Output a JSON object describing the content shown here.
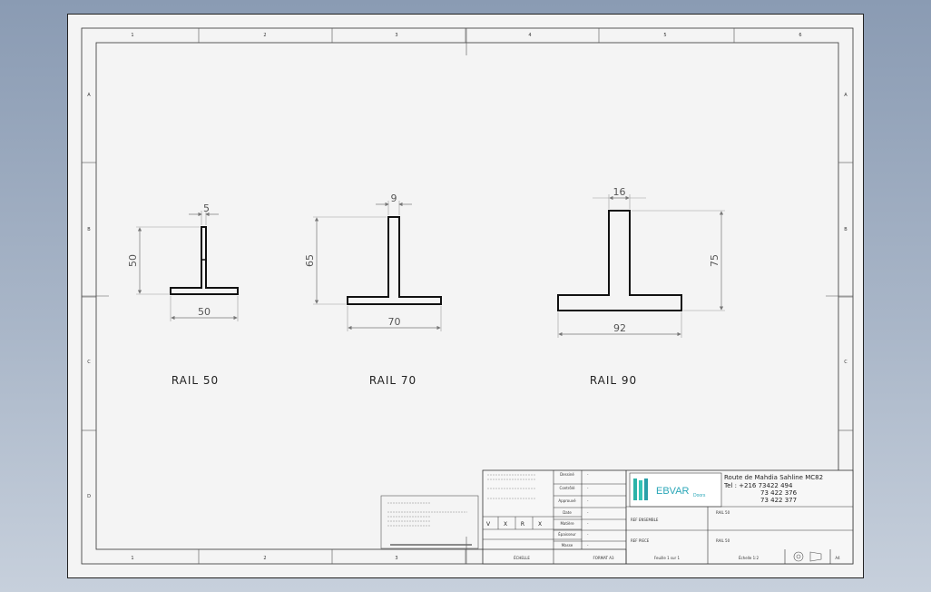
{
  "zones": {
    "columns": [
      "1",
      "2",
      "3",
      "4",
      "5",
      "6"
    ],
    "rows": [
      "A",
      "B",
      "C",
      "D"
    ]
  },
  "rails": [
    {
      "label": "RAIL 50",
      "width_dim": "50",
      "height_dim": "50",
      "stem_dim": "5"
    },
    {
      "label": "RAIL 70",
      "width_dim": "70",
      "height_dim": "65",
      "stem_dim": "9"
    },
    {
      "label": "RAIL 90",
      "width_dim": "92",
      "height_dim": "75",
      "stem_dim": "16"
    }
  ],
  "title_block": {
    "company": {
      "logo_text": "EBVAR",
      "logo_sub": "Doors",
      "address": "Route de Mahdia Sahline MC82",
      "tel1": "Tel : +216 73422 494",
      "tel2": "73 422 376",
      "tel3": "73 422 377"
    },
    "rows": [
      {
        "label": "Dessiné",
        "value": "-"
      },
      {
        "label": "Contrôlé",
        "value": "-"
      },
      {
        "label": "Approuvé",
        "value": "-"
      },
      {
        "label": "Date",
        "value": "-"
      },
      {
        "label": "Matière",
        "value": "-"
      },
      {
        "label": "Épaisseur",
        "value": "-"
      },
      {
        "label": "Masse",
        "value": "-"
      }
    ],
    "checks": [
      "V",
      "X",
      "R",
      "X"
    ],
    "ref_assembly_label": "REF ENSEMBLE",
    "ref_assembly_value": "RAIL 50",
    "ref_label": "REF PIECE",
    "ref_value": "RAIL 50",
    "bottom_cells": [
      "ÉCHELLE",
      "FORMAT A3",
      "Feuille 1 sur 1",
      "Échelle 1:2",
      "A4"
    ]
  }
}
